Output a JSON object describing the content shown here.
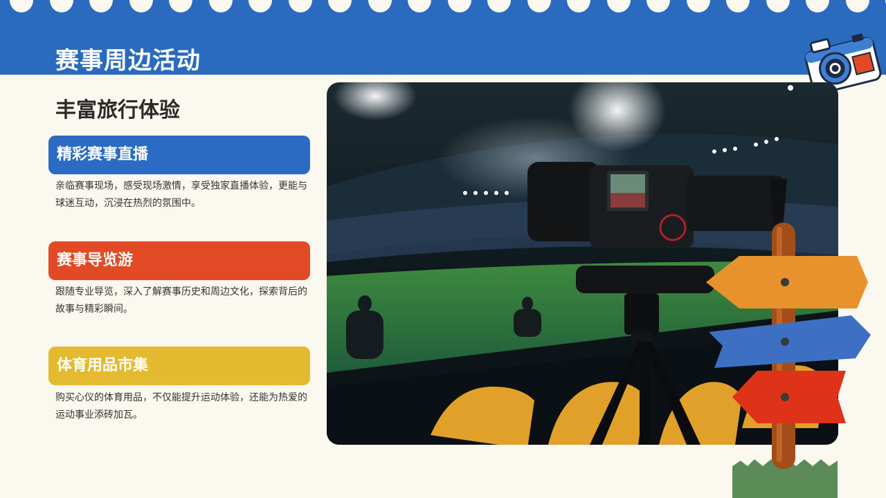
{
  "page_title": "赛事周边活动",
  "subtitle": "丰富旅行体验",
  "cards": [
    {
      "title": "精彩赛事直播",
      "description": "亲临赛事现场，感受现场激情，享受独家直播体验，更能与球迷互动，沉浸在热烈的氛围中。",
      "color": "#2b6bc4"
    },
    {
      "title": "赛事导览游",
      "description": "跟随专业导览，深入了解赛事历史和周边文化，探索背后的故事与精彩瞬间。",
      "color": "#e14a25"
    },
    {
      "title": "体育用品市集",
      "description": "购买心仪的体育用品，不仅能提升运动体验，还能为热爱的运动事业添砖加瓦。",
      "color": "#e4bb30"
    }
  ],
  "colors": {
    "header": "#2b6bbf",
    "background": "#fbf8f0",
    "sign_orange": "#e8922d",
    "sign_blue": "#3d6fc2",
    "sign_red": "#de3318",
    "sign_post": "#a34e1a",
    "grass": "#5b8c57"
  },
  "icons": [
    "camera-sticker-icon",
    "signpost-icon",
    "stadium-camera-photo"
  ]
}
